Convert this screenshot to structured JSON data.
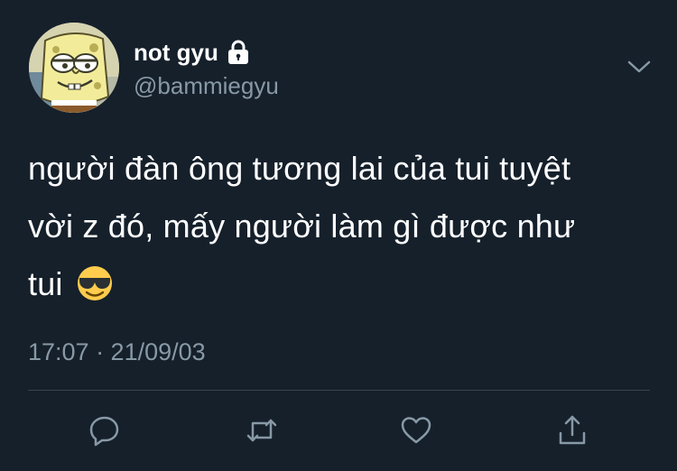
{
  "user": {
    "display_name": "not gyu",
    "handle": "@bammiegyu",
    "avatar_icon": "spongebob-avatar",
    "protected_icon": "lock-icon"
  },
  "tweet": {
    "line1": "người đàn ông tương lai của tui tuyệt",
    "line2": "vời z đó, mấy người làm gì được như",
    "line3": "tui",
    "emoji": "smiling-face-with-sunglasses",
    "timestamp": "17:07 · 21/09/03"
  },
  "menu": {
    "icon": "chevron-down-icon"
  },
  "actions": [
    {
      "name": "reply",
      "icon": "reply-icon"
    },
    {
      "name": "retweet",
      "icon": "retweet-icon"
    },
    {
      "name": "like",
      "icon": "heart-icon"
    },
    {
      "name": "share",
      "icon": "share-icon"
    }
  ],
  "colors": {
    "background": "#15202b",
    "primary_text": "#ffffff",
    "secondary_text": "#8899a6",
    "divider": "#38444d"
  }
}
